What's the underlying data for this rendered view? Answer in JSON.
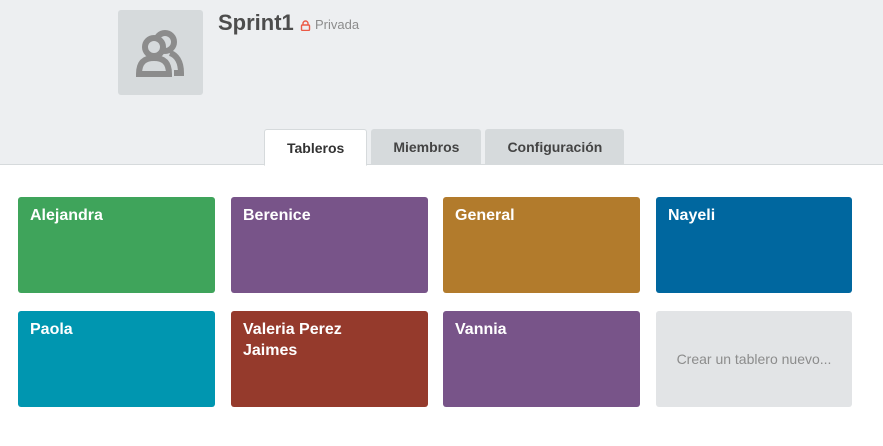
{
  "team": {
    "name": "Sprint1",
    "privacy_label": "Privada",
    "avatar_icon": "team-members-icon"
  },
  "tabs": [
    {
      "label": "Tableros",
      "active": true
    },
    {
      "label": "Miembros",
      "active": false
    },
    {
      "label": "Configuración",
      "active": false
    }
  ],
  "boards": [
    {
      "title": "Alejandra",
      "color": "#3fa45b"
    },
    {
      "title": "Berenice",
      "color": "#785489"
    },
    {
      "title": "General",
      "color": "#b27b2c"
    },
    {
      "title": "Nayeli",
      "color": "#00679f"
    },
    {
      "title": "Paola",
      "color": "#0096b0"
    },
    {
      "title": "Valeria Perez Jaimes",
      "color": "#953a2c"
    },
    {
      "title": "Vannia",
      "color": "#785489"
    }
  ],
  "create_board_label": "Crear un tablero nuevo..."
}
